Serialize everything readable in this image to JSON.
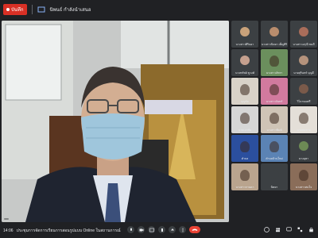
{
  "topbar": {
    "rec_label": "บันทึก",
    "presenter_text": "นิพนธ์ กำลังนำเสนอ"
  },
  "main_video": {
    "participant_name": ""
  },
  "tiles": [
    {
      "name": "นางสาวศิรินยา",
      "kind": "avatar",
      "color": "#c9a27a"
    },
    {
      "name": "นางสาวนิตยา เพ็ญศิริ",
      "kind": "avatar",
      "color": "#b98d6d"
    },
    {
      "name": "นางสาวอรุณี ชมดี",
      "kind": "avatar",
      "color": "#a96d5a"
    },
    {
      "name": "นางทรัพย์ ชูวงศ์",
      "kind": "avatar",
      "color": "#c5a08e"
    },
    {
      "name": "นางสาวภัทรา",
      "kind": "video",
      "color": "#6b8f5d"
    },
    {
      "name": "นายสุรินทร์ บุญมี",
      "kind": "avatar",
      "color": "#b5937c"
    },
    {
      "name": "บุญชัย",
      "kind": "video",
      "color": "#d8d2c8"
    },
    {
      "name": "นางสาวจันทร์",
      "kind": "video",
      "color": "#d17a9e"
    },
    {
      "name": "วิไล ทองศรี",
      "kind": "avatar",
      "color": "#7a5a4a"
    },
    {
      "name": "นายเอกชัย",
      "kind": "video",
      "color": "#d6d6d6"
    },
    {
      "name": "นางสาวพิมพ์",
      "kind": "video",
      "color": "#cfc4b6"
    },
    {
      "name": "นายสมชาย",
      "kind": "video",
      "color": "#e4dfd8"
    },
    {
      "name": "ตำบล",
      "kind": "video",
      "color": "#2b4f9e"
    },
    {
      "name": "ตำบลบ้านใหม่",
      "kind": "video",
      "color": "#5b83b4"
    },
    {
      "name": "นางอุษา",
      "kind": "avatar",
      "color": "#6d8a55"
    },
    {
      "name": "นางสาวกานดา",
      "kind": "video",
      "color": "#b9a48e"
    },
    {
      "name": "นิตยา",
      "kind": "avatar",
      "color": "#3c4043"
    },
    {
      "name": "นางสาวสมใจ",
      "kind": "video",
      "color": "#8a6d59"
    }
  ],
  "bottombar": {
    "time": "14:06",
    "meeting_title": "ประชุมการจัดการเรียนการสอนรูปแบบ Online ในสถานการณ์"
  },
  "colors": {
    "accent_red": "#d93025",
    "end_call": "#ea4335"
  }
}
